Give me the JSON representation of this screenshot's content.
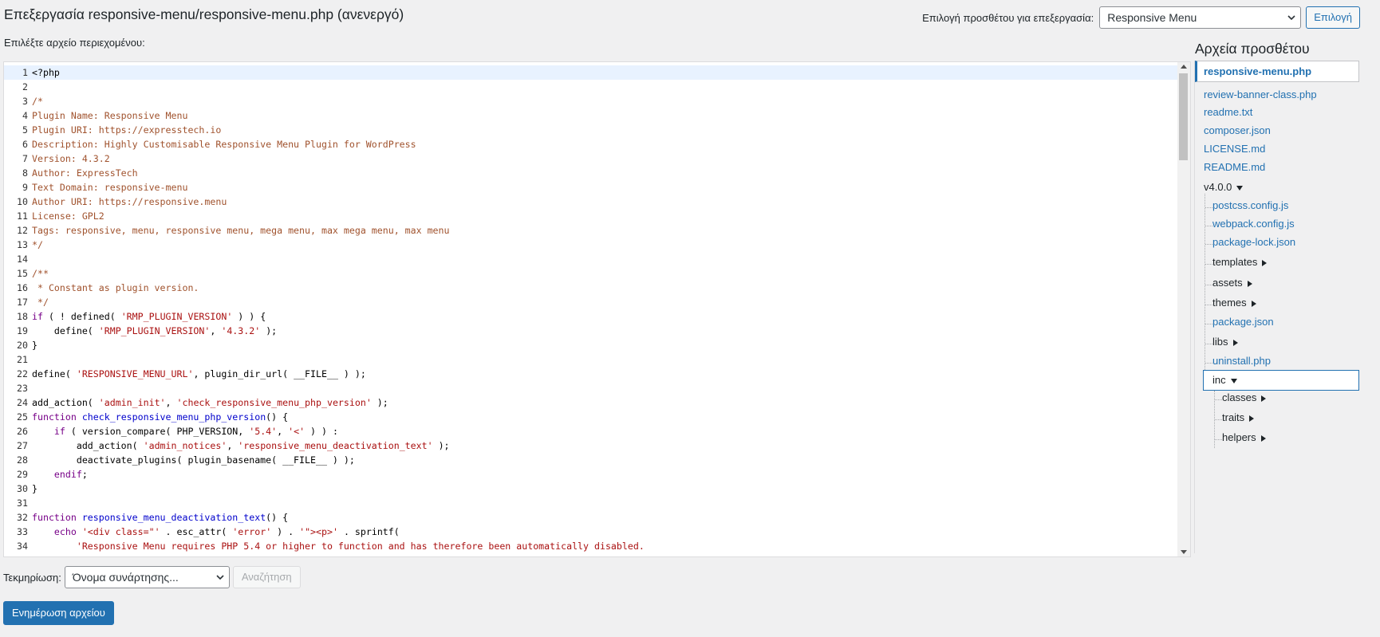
{
  "header": {
    "title": "Επεξεργασία responsive-menu/responsive-menu.php (ανενεργό)",
    "plugin_select_label": "Επιλογή προσθέτου για επεξεργασία:",
    "plugin_select_value": "Responsive Menu",
    "select_button": "Επιλογή"
  },
  "editor": {
    "content_label": "Επιλέξτε αρχείο περιεχομένου:",
    "lines": [
      {
        "n": "1",
        "html": "&lt;?php"
      },
      {
        "n": "2",
        "html": ""
      },
      {
        "n": "3",
        "html": "<span class=\"c\">/*</span>"
      },
      {
        "n": "4",
        "html": "<span class=\"c\">Plugin Name: Responsive Menu</span>"
      },
      {
        "n": "5",
        "html": "<span class=\"c\">Plugin URI: https://expresstech.io</span>"
      },
      {
        "n": "6",
        "html": "<span class=\"c\">Description: Highly Customisable Responsive Menu Plugin for WordPress</span>"
      },
      {
        "n": "7",
        "html": "<span class=\"c\">Version: 4.3.2</span>"
      },
      {
        "n": "8",
        "html": "<span class=\"c\">Author: ExpressTech</span>"
      },
      {
        "n": "9",
        "html": "<span class=\"c\">Text Domain: responsive-menu</span>"
      },
      {
        "n": "10",
        "html": "<span class=\"c\">Author URI: https://responsive.menu</span>"
      },
      {
        "n": "11",
        "html": "<span class=\"c\">License: GPL2</span>"
      },
      {
        "n": "12",
        "html": "<span class=\"c\">Tags: responsive, menu, responsive menu, mega menu, max mega menu, max menu</span>"
      },
      {
        "n": "13",
        "html": "<span class=\"c\">*/</span>"
      },
      {
        "n": "14",
        "html": ""
      },
      {
        "n": "15",
        "html": "<span class=\"c\">/**</span>"
      },
      {
        "n": "16",
        "html": "<span class=\"c\"> * Constant as plugin version.</span>"
      },
      {
        "n": "17",
        "html": "<span class=\"c\"> */</span>"
      },
      {
        "n": "18",
        "html": "<span class=\"k\">if</span> ( ! defined( <span class=\"s\">'RMP_PLUGIN_VERSION'</span> ) ) {"
      },
      {
        "n": "19",
        "html": "    define( <span class=\"s\">'RMP_PLUGIN_VERSION'</span>, <span class=\"s\">'4.3.2'</span> );"
      },
      {
        "n": "20",
        "html": "}"
      },
      {
        "n": "21",
        "html": ""
      },
      {
        "n": "22",
        "html": "define( <span class=\"s\">'RESPONSIVE_MENU_URL'</span>, plugin_dir_url( __FILE__ ) );"
      },
      {
        "n": "23",
        "html": ""
      },
      {
        "n": "24",
        "html": "add_action( <span class=\"s\">'admin_init'</span>, <span class=\"s\">'check_responsive_menu_php_version'</span> );"
      },
      {
        "n": "25",
        "html": "<span class=\"k\">function</span> <span class=\"f\">check_responsive_menu_php_version</span>() {"
      },
      {
        "n": "26",
        "html": "    <span class=\"k\">if</span> ( version_compare( PHP_VERSION, <span class=\"s\">'5.4'</span>, <span class=\"s\">'&lt;'</span> ) ) :"
      },
      {
        "n": "27",
        "html": "        add_action( <span class=\"s\">'admin_notices'</span>, <span class=\"s\">'responsive_menu_deactivation_text'</span> );"
      },
      {
        "n": "28",
        "html": "        deactivate_plugins( plugin_basename( __FILE__ ) );"
      },
      {
        "n": "29",
        "html": "    <span class=\"k\">endif</span>;"
      },
      {
        "n": "30",
        "html": "}"
      },
      {
        "n": "31",
        "html": ""
      },
      {
        "n": "32",
        "html": "<span class=\"k\">function</span> <span class=\"f\">responsive_menu_deactivation_text</span>() {"
      },
      {
        "n": "33",
        "html": "    <span class=\"k\">echo</span> <span class=\"s\">'&lt;div class=\"'</span> . esc_attr( <span class=\"s\">'error'</span> ) . <span class=\"s\">'\"&gt;&lt;p&gt;'</span> . sprintf("
      },
      {
        "n": "34",
        "html": "        <span class=\"s\">'Responsive Menu requires PHP 5.4 or higher to function and has therefore been automatically disabled.</span>"
      }
    ]
  },
  "sidebar": {
    "title": "Αρχεία προσθέτου",
    "selected_file": "responsive-menu.php",
    "files": [
      "review-banner-class.php",
      "readme.txt",
      "composer.json",
      "LICENSE.md",
      "README.md"
    ],
    "folder_v4": "v4.0.0",
    "v4_children": [
      "postcss.config.js",
      "webpack.config.js",
      "package-lock.json"
    ],
    "v4_dirs_a": [
      "templates",
      "assets",
      "themes"
    ],
    "v4_file_b": "package.json",
    "v4_dir_c": "libs",
    "v4_file_d": "uninstall.php",
    "inc": "inc",
    "inc_children": [
      "classes",
      "traits",
      "helpers"
    ]
  },
  "footer": {
    "doc_label": "Τεκμηρίωση:",
    "doc_select": "Όνομα συνάρτησης...",
    "lookup_button": "Αναζήτηση",
    "update_button": "Ενημέρωση αρχείου"
  }
}
